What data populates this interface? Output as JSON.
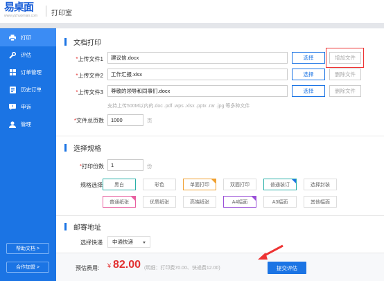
{
  "header": {
    "logo_text": "易桌面",
    "logo_sub": "www.yizhuomian.com",
    "title": "打印室"
  },
  "sidebar": {
    "items": [
      {
        "label": "打印",
        "icon": "printer-icon",
        "active": true
      },
      {
        "label": "评估",
        "icon": "tools-icon",
        "active": false
      },
      {
        "label": "订单管理",
        "icon": "grid-icon",
        "active": false
      },
      {
        "label": "历史订单",
        "icon": "history-icon",
        "active": false
      },
      {
        "label": "申诉",
        "icon": "appeal-icon",
        "active": false
      },
      {
        "label": "管理",
        "icon": "user-icon",
        "active": false
      }
    ],
    "help_label": "帮助文档 >",
    "partner_label": "合作加盟 >"
  },
  "doc_print": {
    "title": "文档打印",
    "files": [
      {
        "label": "*上传文件1",
        "value": "建议信.docx",
        "choose": "选择",
        "action": "增加文件"
      },
      {
        "label": "*上传文件2",
        "value": "工作汇报.xlsx",
        "choose": "选择",
        "action": "删除文件"
      },
      {
        "label": "*上传文件3",
        "value": "尊敬的领导和同事们.docx",
        "choose": "选择",
        "action": "删除文件"
      }
    ],
    "hint": "支持上传500M以内的.doc .pdf .wps .xlsx .pptx .rar .jpg 等多种文件",
    "pages_label": "*文件总页数",
    "pages_value": "1000",
    "pages_unit": "页"
  },
  "spec": {
    "title": "选择规格",
    "copies_label": "*打印份数",
    "copies_value": "1",
    "copies_unit": "份",
    "spec_label": "规格选择",
    "row1": [
      "黑白",
      "彩色",
      "单面打印",
      "双面打印",
      "普通装订",
      "选择封装"
    ],
    "row2": [
      "普通纸张",
      "优质纸张",
      "高端纸张",
      "A4幅面",
      "A3幅面",
      "其他幅面"
    ]
  },
  "mail": {
    "title": "邮寄地址",
    "express_label": "选择快递",
    "express_value": "中通快递"
  },
  "footer": {
    "fee_label": "预估费用:",
    "currency": "¥",
    "fee_value": "82.00",
    "fee_detail": "(明细：打印费70.00、快递费12.00)",
    "submit": "提交评估"
  },
  "colors": {
    "brand": "#1b74e4",
    "price": "#e23030",
    "highlight": "#e33333"
  }
}
